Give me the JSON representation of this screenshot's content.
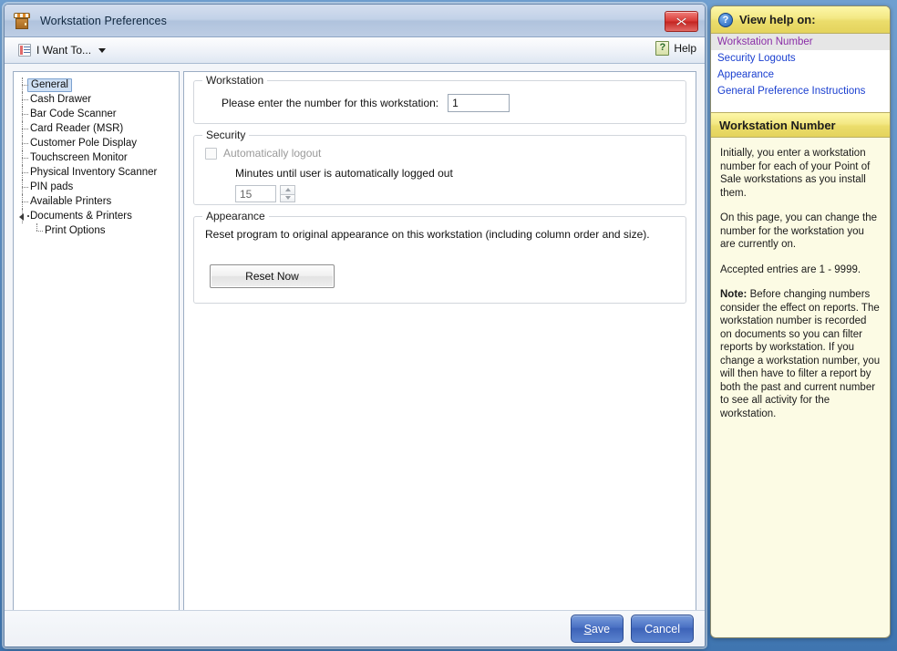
{
  "window": {
    "title": "Workstation Preferences",
    "icon": "storefront-icon",
    "close_label": "✕"
  },
  "toolbar": {
    "i_want_to_label": "I Want To...",
    "help_label": "Help",
    "help_icon_glyph": "?"
  },
  "tree": {
    "items": [
      {
        "label": "General",
        "level": 0,
        "selected": true,
        "expander": false
      },
      {
        "label": "Cash Drawer",
        "level": 0,
        "selected": false,
        "expander": false
      },
      {
        "label": "Bar Code Scanner",
        "level": 0,
        "selected": false,
        "expander": false
      },
      {
        "label": "Card Reader (MSR)",
        "level": 0,
        "selected": false,
        "expander": false
      },
      {
        "label": "Customer Pole Display",
        "level": 0,
        "selected": false,
        "expander": false
      },
      {
        "label": "Touchscreen Monitor",
        "level": 0,
        "selected": false,
        "expander": false
      },
      {
        "label": "Physical Inventory Scanner",
        "level": 0,
        "selected": false,
        "expander": false
      },
      {
        "label": "PIN pads",
        "level": 0,
        "selected": false,
        "expander": false
      },
      {
        "label": "Available Printers",
        "level": 0,
        "selected": false,
        "expander": false
      },
      {
        "label": "Documents & Printers",
        "level": 0,
        "selected": false,
        "expander": true
      },
      {
        "label": "Print Options",
        "level": 1,
        "selected": false,
        "expander": false
      }
    ]
  },
  "content": {
    "workstation_group": {
      "title": "Workstation",
      "field_label": "Please enter the number for this workstation:",
      "field_value": "1"
    },
    "security_group": {
      "title": "Security",
      "checkbox_label": "Automatically logout",
      "checkbox_checked": false,
      "minutes_label": "Minutes until user is automatically logged out",
      "minutes_value": "15"
    },
    "appearance_group": {
      "title": "Appearance",
      "description": "Reset program to original appearance on this workstation (including column order and size).",
      "reset_button_label": "Reset Now"
    }
  },
  "footer": {
    "save_label": "Save",
    "save_accel": "S",
    "save_rest": "ave",
    "cancel_label": "Cancel"
  },
  "help": {
    "header_title": "View help on:",
    "links": [
      {
        "label": "Workstation Number",
        "visited": true
      },
      {
        "label": "Security Logouts",
        "visited": false
      },
      {
        "label": "Appearance",
        "visited": false
      },
      {
        "label": "General Preference Instructions",
        "visited": false
      }
    ],
    "subheader_title": "Workstation Number",
    "paragraphs": [
      "Initially, you enter a workstation number for each of your Point of Sale workstations as you install them.",
      "On this page, you can change the number for the workstation you are currently on.",
      "Accepted entries are 1 - 9999."
    ],
    "note_label": "Note:",
    "note_text": " Before changing numbers consider the effect on reports. The workstation number is recorded on documents so you can filter reports by workstation. If you change a workstation number, you will then have to filter a report by both the past and current number to see all activity for the workstation."
  },
  "colors": {
    "titlebar": "#c3d2e8",
    "help_yellow": "#f0e278",
    "help_bg": "#fcfbe4",
    "accent_blue": "#4a71c4",
    "close_red": "#d93b37",
    "link_blue": "#1a3fd0",
    "link_visited": "#8b2fa8"
  }
}
